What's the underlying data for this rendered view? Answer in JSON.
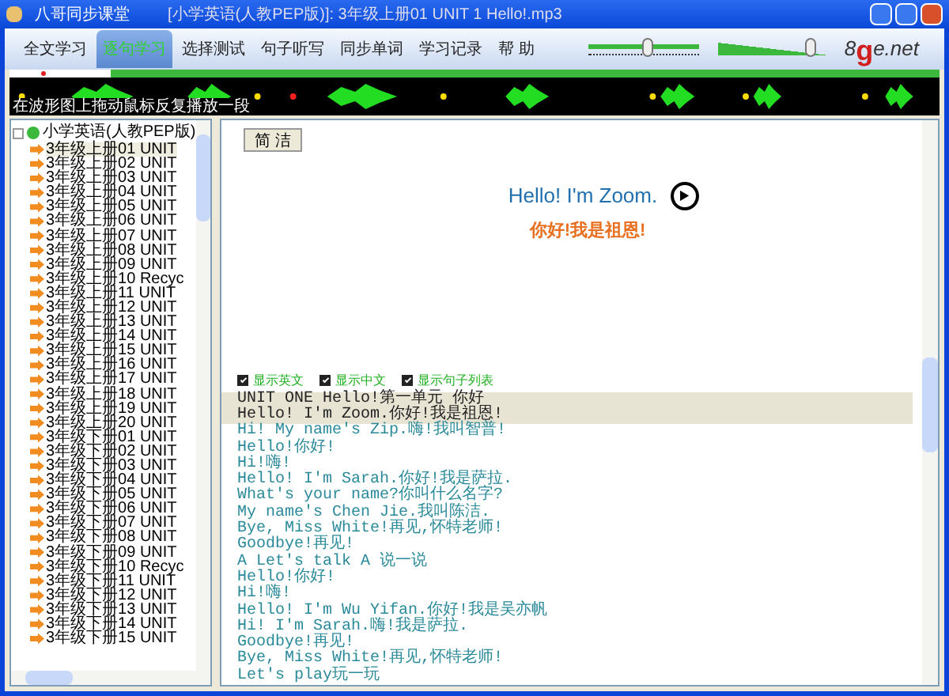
{
  "window": {
    "title": "八哥同步课堂",
    "subtitle": "[小学英语(人教PEP版)]: 3年级上册01 UNIT 1 Hello!.mp3"
  },
  "tabs": [
    {
      "label": "全文学习",
      "selected": false
    },
    {
      "label": "逐句学习",
      "selected": true
    },
    {
      "label": "选择测试",
      "selected": false
    },
    {
      "label": "句子听写",
      "selected": false
    },
    {
      "label": "同步单词",
      "selected": false
    },
    {
      "label": "学习记录",
      "selected": false
    },
    {
      "label": "帮 助",
      "selected": false
    }
  ],
  "speed_slider": {
    "level": 0.55
  },
  "volume_slider": {
    "level": 0.85
  },
  "logo": {
    "prefix": "8",
    "mark": "g",
    "suffix": "e.net"
  },
  "waveform": {
    "hint": "在波形图上拖动鼠标反复播放一段"
  },
  "tree": {
    "root": "小学英语(人教PEP版)",
    "children": [
      {
        "label": "3年级上册01 UNIT",
        "selected": true
      },
      {
        "label": "3年级上册02 UNIT",
        "selected": false
      },
      {
        "label": "3年级上册03 UNIT",
        "selected": false
      },
      {
        "label": "3年级上册04 UNIT",
        "selected": false
      },
      {
        "label": "3年级上册05 UNIT",
        "selected": false
      },
      {
        "label": "3年级上册06 UNIT",
        "selected": false
      },
      {
        "label": "3年级上册07 UNIT",
        "selected": false
      },
      {
        "label": "3年级上册08 UNIT",
        "selected": false
      },
      {
        "label": "3年级上册09 UNIT",
        "selected": false
      },
      {
        "label": "3年级上册10 Recyc",
        "selected": false
      },
      {
        "label": "3年级上册11 UNIT",
        "selected": false
      },
      {
        "label": "3年级上册12 UNIT",
        "selected": false
      },
      {
        "label": "3年级上册13 UNIT",
        "selected": false
      },
      {
        "label": "3年级上册14 UNIT",
        "selected": false
      },
      {
        "label": "3年级上册15 UNIT",
        "selected": false
      },
      {
        "label": "3年级上册16 UNIT",
        "selected": false
      },
      {
        "label": "3年级上册17 UNIT",
        "selected": false
      },
      {
        "label": "3年级上册18 UNIT",
        "selected": false
      },
      {
        "label": "3年级上册19 UNIT",
        "selected": false
      },
      {
        "label": "3年级上册20 UNIT",
        "selected": false
      },
      {
        "label": "3年级下册01 UNIT",
        "selected": false
      },
      {
        "label": "3年级下册02 UNIT",
        "selected": false
      },
      {
        "label": "3年级下册03 UNIT",
        "selected": false
      },
      {
        "label": "3年级下册04 UNIT",
        "selected": false
      },
      {
        "label": "3年级下册05 UNIT",
        "selected": false
      },
      {
        "label": "3年级下册06 UNIT",
        "selected": false
      },
      {
        "label": "3年级下册07 UNIT",
        "selected": false
      },
      {
        "label": "3年级下册08 UNIT",
        "selected": false
      },
      {
        "label": "3年级下册09 UNIT",
        "selected": false
      },
      {
        "label": "3年级下册10 Recyc",
        "selected": false
      },
      {
        "label": "3年级下册11 UNIT",
        "selected": false
      },
      {
        "label": "3年级下册12 UNIT",
        "selected": false
      },
      {
        "label": "3年级下册13 UNIT",
        "selected": false
      },
      {
        "label": "3年级下册14 UNIT",
        "selected": false
      },
      {
        "label": "3年级下册15 UNIT",
        "selected": false
      }
    ]
  },
  "mode_button": "简 洁",
  "current": {
    "english": "Hello! I'm Zoom.",
    "chinese": "你好!我是祖恩!"
  },
  "options": [
    {
      "label": "显示英文",
      "checked": true
    },
    {
      "label": "显示中文",
      "checked": true
    },
    {
      "label": "显示句子列表",
      "checked": true
    }
  ],
  "sentences": [
    {
      "text": "UNIT ONE  Hello!第一单元 你好",
      "selected": true
    },
    {
      "text": "Hello! I'm Zoom.你好!我是祖恩!",
      "selected": true
    },
    {
      "text": "Hi! My name's Zip.嗨!我叫智普!",
      "selected": false
    },
    {
      "text": "Hello!你好!",
      "selected": false
    },
    {
      "text": "Hi!嗨!",
      "selected": false
    },
    {
      "text": "Hello! I'm Sarah.你好!我是萨拉.",
      "selected": false
    },
    {
      "text": "What's your name?你叫什么名字?",
      "selected": false
    },
    {
      "text": "My name's Chen Jie.我叫陈洁.",
      "selected": false
    },
    {
      "text": "Bye, Miss White!再见,怀特老师!",
      "selected": false
    },
    {
      "text": "Goodbye!再见!",
      "selected": false
    },
    {
      "text": "A  Let's talk  A 说一说",
      "selected": false
    },
    {
      "text": "Hello!你好!",
      "selected": false
    },
    {
      "text": "Hi!嗨!",
      "selected": false
    },
    {
      "text": "Hello! I'm Wu Yifan.你好!我是吴亦帆",
      "selected": false
    },
    {
      "text": "Hi! I'm Sarah.嗨!我是萨拉.",
      "selected": false
    },
    {
      "text": "Goodbye!再见!",
      "selected": false
    },
    {
      "text": "Bye, Miss White!再见,怀特老师!",
      "selected": false
    },
    {
      "text": "Let's play玩一玩",
      "selected": false
    }
  ]
}
